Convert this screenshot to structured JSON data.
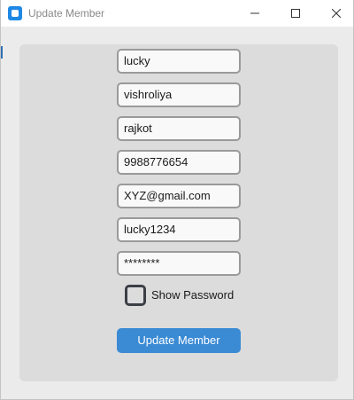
{
  "window": {
    "title": "Update Member",
    "icon": "app-icon",
    "controls": {
      "minimize_icon": "minimize-icon",
      "maximize_icon": "maximize-icon",
      "close_icon": "close-icon"
    }
  },
  "form": {
    "first_name": "lucky",
    "last_name": "vishroliya",
    "city": "rajkot",
    "phone": "9988776654",
    "email": "XYZ@gmail.com",
    "username": "lucky1234",
    "password": "********",
    "show_password_label": "Show Password",
    "show_password_checked": false,
    "submit_label": "Update Member"
  },
  "colors": {
    "accent": "#3a8ad4",
    "panel": "#dcdcdc",
    "background": "#ebebeb"
  }
}
